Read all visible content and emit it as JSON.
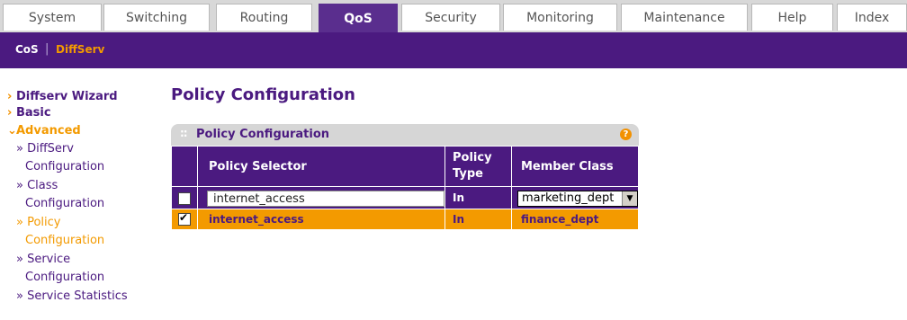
{
  "top_tabs": [
    "System",
    "Switching",
    "Routing",
    "QoS",
    "Security",
    "Monitoring",
    "Maintenance",
    "Help",
    "Index"
  ],
  "active_tab": "QoS",
  "subnav": {
    "items": [
      "CoS",
      "DiffServ"
    ],
    "active": "DiffServ",
    "separator": "|"
  },
  "sidebar": {
    "wizard": "Diffserv Wizard",
    "basic": "Basic",
    "advanced": "Advanced",
    "items": [
      {
        "line1": "» DiffServ",
        "line2": "Configuration"
      },
      {
        "line1": "» Class",
        "line2": "Configuration"
      },
      {
        "line1": "» Policy",
        "line2": "Configuration"
      },
      {
        "line1": "» Service",
        "line2": "Configuration"
      },
      {
        "line1": "» Service Statistics",
        "line2": ""
      }
    ]
  },
  "page_title": "Policy Configuration",
  "panel": {
    "title": "Policy Configuration",
    "help": "?"
  },
  "table": {
    "headers": {
      "selector": "Policy Selector",
      "type_line1": "Policy",
      "type_line2": "Type",
      "member": "Member Class"
    },
    "entry": {
      "name_value": "internet_access",
      "type": "In",
      "member_selected": "marketing_dept"
    },
    "rows": [
      {
        "selector": "internet_access",
        "type": "In",
        "member": "finance_dept",
        "checked": true
      }
    ]
  },
  "colors": {
    "brand_purple": "#4b1a80",
    "accent_orange": "#f39a00"
  }
}
